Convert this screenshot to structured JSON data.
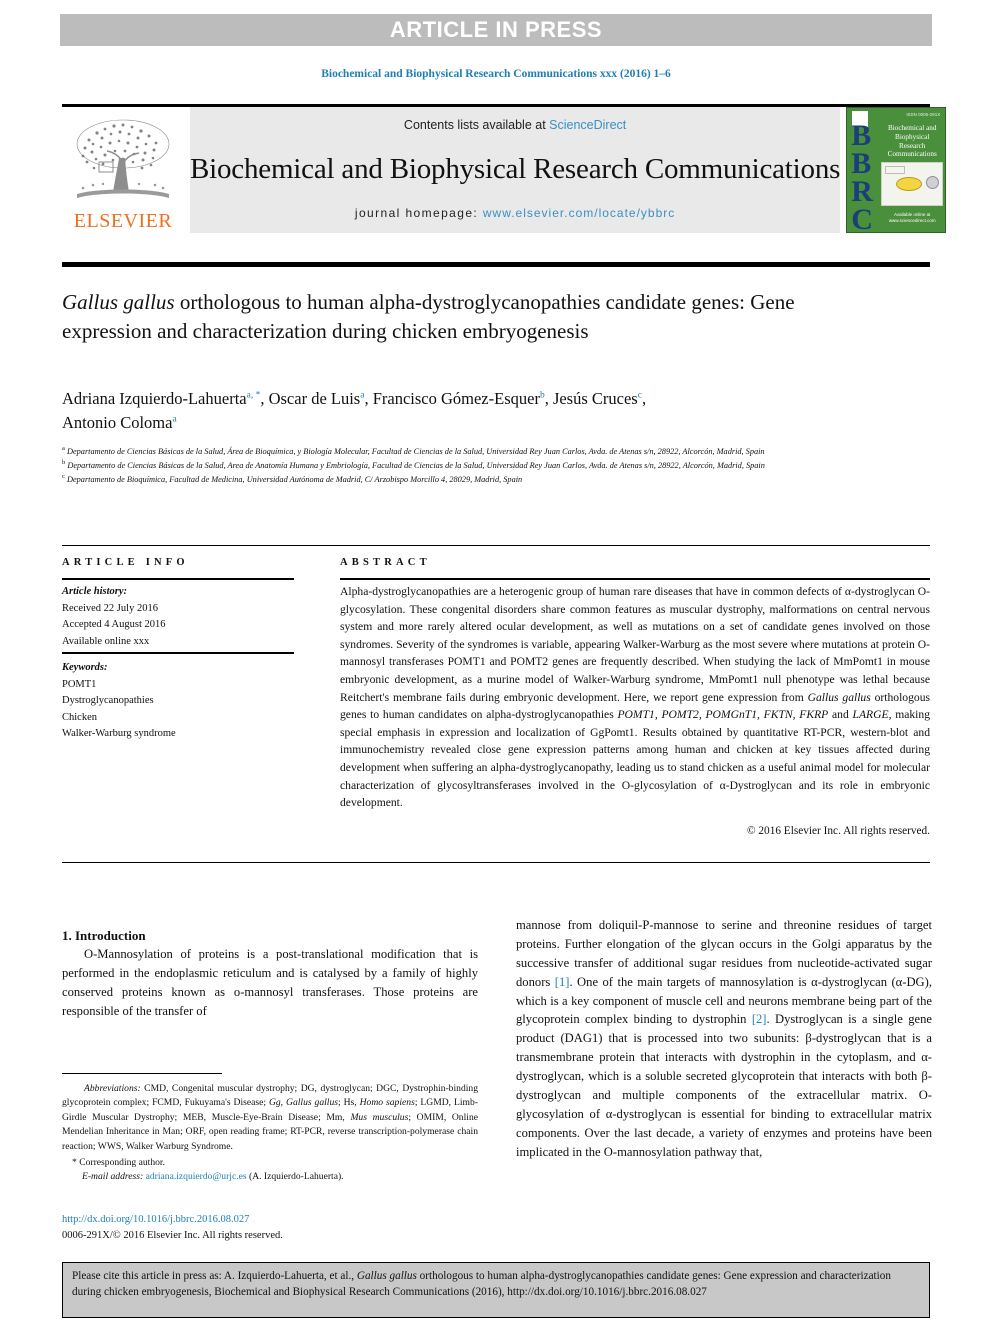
{
  "banner": {
    "label": "ARTICLE IN PRESS"
  },
  "running_head": "Biochemical and Biophysical Research Communications xxx (2016) 1–6",
  "journal_header": {
    "contents_prefix": "Contents lists available at ",
    "sciencedirect": "ScienceDirect",
    "journal_name": "Biochemical and Biophysical Research Communications",
    "homepage_prefix": "journal homepage: ",
    "homepage_url": "www.elsevier.com/locate/ybbrc",
    "elsevier_wordmark": "ELSEVIER",
    "cover": {
      "letters": "BBRC",
      "title": "Biochemical and Biophysical Research Communications",
      "top_right": "ISSN 0006-291X",
      "bottom": "Available online at www.sciencedirect.com"
    }
  },
  "article": {
    "title_part1": "Gallus gallus",
    "title_part2": " orthologous to human alpha-dystroglycanopathies candidate genes: Gene expression and characterization during chicken embryogenesis",
    "authors": [
      {
        "name": "Adriana Izquierdo-Lahuerta",
        "marks": "a, *"
      },
      {
        "name": "Oscar de Luis",
        "marks": "a"
      },
      {
        "name": "Francisco Gómez-Esquer",
        "marks": "b"
      },
      {
        "name": "Jesús Cruces",
        "marks": "c"
      },
      {
        "name": "Antonio Coloma",
        "marks": "a"
      }
    ],
    "affiliations": [
      {
        "mark": "a",
        "text": "Departamento de Ciencias Básicas de la Salud, Área de Bioquímica, y Biología Molecular, Facultad de Ciencias de la Salud, Universidad Rey Juan Carlos, Avda. de Atenas s/n, 28922, Alcorcón, Madrid, Spain"
      },
      {
        "mark": "b",
        "text": "Departamento de Ciencias Básicas de la Salud, Area de Anatomía Humana y Embriología, Facultad de Ciencias de la Salud, Universidad Rey Juan Carlos, Avda. de Atenas s/n, 28922, Alcorcón, Madrid, Spain"
      },
      {
        "mark": "c",
        "text": "Departamento de Bioquímica, Facultad de Medicina, Universidad Autónoma de Madrid, C/ Arzobispo Morcillo 4, 28029, Madrid, Spain"
      }
    ]
  },
  "article_info": {
    "heading": "ARTICLE INFO",
    "history_label": "Article history:",
    "history": [
      "Received 22 July 2016",
      "Accepted 4 August 2016",
      "Available online xxx"
    ],
    "keywords_label": "Keywords:",
    "keywords": [
      "POMT1",
      "Dystroglycanopathies",
      "Chicken",
      "Walker-Warburg syndrome"
    ]
  },
  "abstract": {
    "heading": "ABSTRACT",
    "text_pre_italic_1": "Alpha-dystroglycanopathies are a heterogenic group of human rare diseases that have in common defects of α-dystroglycan O-glycosylation. These congenital disorders share common features as muscular dystrophy, malformations on central nervous system and more rarely altered ocular development, as well as mutations on a set of candidate genes involved on those syndromes. Severity of the syndromes is variable, appearing Walker-Warburg as the most severe where mutations at protein O-mannosyl transferases POMT1 and POMT2 genes are frequently described. When studying the lack of MmPomt1 in mouse embryonic development, as a murine model of Walker-Warburg syndrome, MmPomt1 null phenotype was lethal because Reitchert's membrane fails during embryonic development. Here, we report gene expression from ",
    "italic_1": "Gallus gallus",
    "text_mid": " orthologous genes to human candidates on alpha-dystroglycanopathies ",
    "italic_2": "POMT1, POMT2, POMGnT1, FKTN, FKRP",
    "text_mid_2": " and ",
    "italic_3": "LARGE",
    "text_post": ", making special emphasis in expression and localization of GgPomt1. Results obtained by quantitative RT-PCR, western-blot and immunochemistry revealed close gene expression patterns among human and chicken at key tissues affected during development when suffering an alpha-dystroglycanopathy, leading us to stand chicken as a useful animal model for molecular characterization of glycosyltransferases involved in the O-glycosylation of α-Dystroglycan and its role in embryonic development.",
    "copyright": "© 2016 Elsevier Inc. All rights reserved."
  },
  "introduction": {
    "heading": "1. Introduction",
    "left_paragraph": "O-Mannosylation of proteins is a post-translational modification that is performed in the endoplasmic reticulum and is catalysed by a family of highly conserved proteins known as o-mannosyl transferases. Those proteins are responsible of the transfer of",
    "right_text_a": "mannose from doliquil-P-mannose to serine and threonine residues of target proteins. Further elongation of the glycan occurs in the Golgi apparatus by the successive transfer of additional sugar residues from nucleotide-activated sugar donors ",
    "right_ref_1": "[1]",
    "right_text_b": ". One of the main targets of mannosylation is α-dystroglycan (α-DG), which is a key component of muscle cell and neurons membrane being part of the glycoprotein complex binding to dystrophin ",
    "right_ref_2": "[2]",
    "right_text_c": ". Dystroglycan is a single gene product (DAG1) that is processed into two subunits: β-dystroglycan that is a transmembrane protein that interacts with dystrophin in the cytoplasm, and α-dystroglycan, which is a soluble secreted glycoprotein that interacts with both β-dystroglycan and multiple components of the extracellular matrix. O-glycosylation of α-dystroglycan is essential for binding to extracellular matrix components. Over the last decade, a variety of enzymes and proteins have been implicated in the O-mannosylation pathway that,"
  },
  "footnotes": {
    "abbrev_label": "Abbreviations:",
    "abbrev_text_1": " CMD, Congenital muscular dystrophy; DG, dystroglycan; DGC, Dystrophin-binding glycoprotein complex; FCMD, Fukuyama's Disease; ",
    "abbrev_italic_1": "Gg, Gallus gallus",
    "abbrev_text_2": "; Hs, ",
    "abbrev_italic_2": "Homo sapiens",
    "abbrev_text_3": "; LGMD, Limb-Girdle Muscular Dystrophy; MEB, Muscle-Eye-Brain Disease; Mm, ",
    "abbrev_italic_3": "Mus musculus",
    "abbrev_text_4": "; OMIM, Online Mendelian Inheritance in Man; ORF, open reading frame; RT-PCR, reverse transcription-polymerase chain reaction; WWS, Walker Warburg Syndrome.",
    "corresponding": "* Corresponding author.",
    "email_label": "E-mail address:",
    "email": "adriana.izquierdo@urjc.es",
    "email_suffix": " (A. Izquierdo-Lahuerta)."
  },
  "doi_block": {
    "doi_url": "http://dx.doi.org/10.1016/j.bbrc.2016.08.027",
    "issn_line": "0006-291X/© 2016 Elsevier Inc. All rights reserved."
  },
  "citation_box": {
    "prefix": "Please cite this article in press as: A. Izquierdo-Lahuerta, et al., ",
    "italic": "Gallus gallus",
    "suffix": " orthologous to human alpha-dystroglycanopathies candidate genes: Gene expression and characterization during chicken embryogenesis, Biochemical and Biophysical Research Communications (2016), http://dx.doi.org/10.1016/j.bbrc.2016.08.027"
  },
  "colors": {
    "link_blue": "#1f7fb5",
    "sciencedirect_blue": "#3a8fc4",
    "elsevier_orange": "#f06f1e",
    "banner_gray": "#bcbcbc",
    "cover_green": "#4a8f3c",
    "cover_letters_blue": "#1a3f7a"
  }
}
